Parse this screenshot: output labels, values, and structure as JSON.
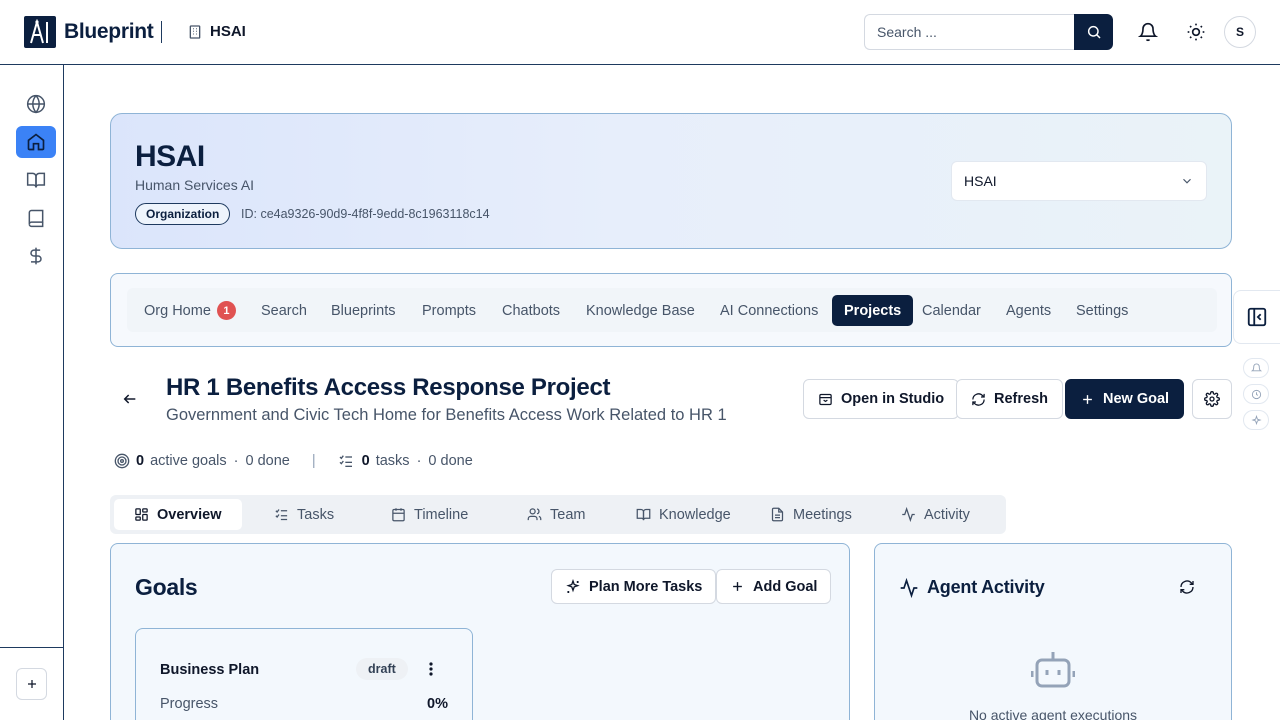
{
  "app": {
    "brand": "Blueprint",
    "logo_text": "AI",
    "breadcrumb": "HSAI"
  },
  "search": {
    "placeholder": "Search ..."
  },
  "user": {
    "initial": "S"
  },
  "org": {
    "name": "HSAI",
    "full_name": "Human Services AI",
    "badge": "Organization",
    "id_text": "ID: ce4a9326-90d9-4f8f-9edd-8c1963118c14",
    "selector_value": "HSAI"
  },
  "nav": {
    "items": [
      {
        "label": "Org Home",
        "badge": "1"
      },
      {
        "label": "Search"
      },
      {
        "label": "Blueprints"
      },
      {
        "label": "Prompts"
      },
      {
        "label": "Chatbots"
      },
      {
        "label": "Knowledge Base"
      },
      {
        "label": "AI Connections"
      },
      {
        "label": "Projects",
        "active": true
      },
      {
        "label": "Calendar"
      },
      {
        "label": "Agents"
      },
      {
        "label": "Settings"
      }
    ]
  },
  "project": {
    "title": "HR 1 Benefits Access Response Project",
    "subtitle": "Government and Civic Tech Home for Benefits Access Work Related to HR 1",
    "actions": {
      "open_studio": "Open in Studio",
      "refresh": "Refresh",
      "new_goal": "New Goal"
    }
  },
  "stats": {
    "active_goals": "0",
    "active_goals_label": "active goals",
    "goals_done": "0 done",
    "tasks": "0",
    "tasks_label": "tasks",
    "tasks_done": "0 done"
  },
  "tabs": [
    {
      "label": "Overview",
      "icon": "layout-grid-icon",
      "active": true
    },
    {
      "label": "Tasks",
      "icon": "list-checks-icon"
    },
    {
      "label": "Timeline",
      "icon": "calendar-icon"
    },
    {
      "label": "Team",
      "icon": "users-icon"
    },
    {
      "label": "Knowledge",
      "icon": "book-open-icon"
    },
    {
      "label": "Meetings",
      "icon": "file-text-icon"
    },
    {
      "label": "Activity",
      "icon": "activity-icon"
    }
  ],
  "goals": {
    "title": "Goals",
    "plan_button": "Plan More Tasks",
    "add_button": "Add Goal",
    "items": [
      {
        "name": "Business Plan",
        "status": "draft",
        "progress_label": "Progress",
        "progress": "0%"
      }
    ]
  },
  "agent_activity": {
    "title": "Agent Activity",
    "empty_text": "No active agent executions"
  },
  "colors": {
    "primary": "#0b1f3f",
    "accent": "#3b82f6",
    "badge_red": "#e05252"
  }
}
